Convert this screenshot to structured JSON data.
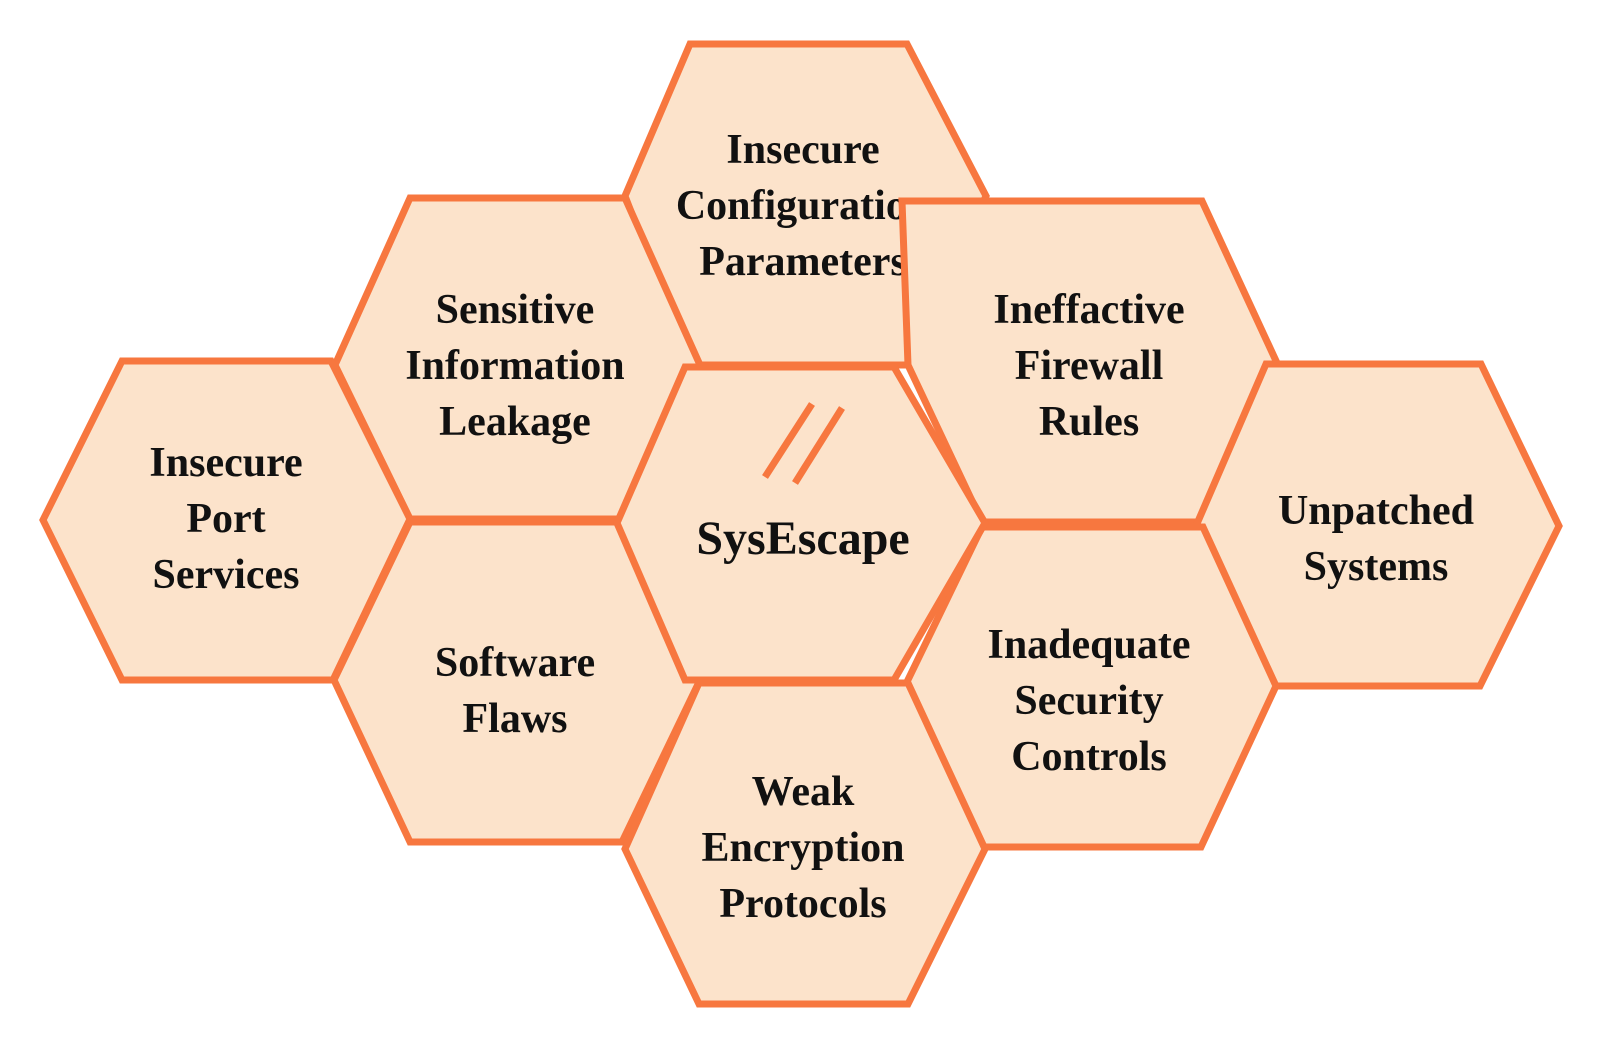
{
  "diagram": {
    "colors": {
      "hex_fill": "#FCE3CB",
      "hex_stroke": "#F7773F",
      "text": "#111111",
      "background": "#FFFFFF"
    },
    "center": {
      "label": "SysEscape",
      "icon": "double-slash-icon"
    },
    "hexagons": [
      {
        "id": "insecure-configuration-parameters",
        "lines": [
          "Insecure",
          "Configuration",
          "Parameters"
        ]
      },
      {
        "id": "sensitive-information-leakage",
        "lines": [
          "Sensitive",
          "Information",
          "Leakage"
        ]
      },
      {
        "id": "ineffactive-firewall-rules",
        "lines": [
          "Ineffactive",
          "Firewall",
          "Rules"
        ]
      },
      {
        "id": "insecure-port-services",
        "lines": [
          "Insecure",
          "Port",
          "Services"
        ]
      },
      {
        "id": "unpatched-systems",
        "lines": [
          "Unpatched",
          "Systems"
        ]
      },
      {
        "id": "software-flaws",
        "lines": [
          "Software",
          "Flaws"
        ]
      },
      {
        "id": "inadequate-security-controls",
        "lines": [
          "Inadequate",
          "Security",
          "Controls"
        ]
      },
      {
        "id": "weak-encryption-protocols",
        "lines": [
          "Weak",
          "Encryption",
          "Protocols"
        ]
      }
    ]
  }
}
